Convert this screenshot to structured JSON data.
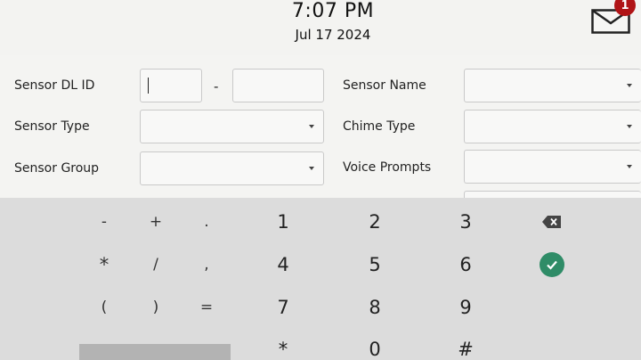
{
  "header": {
    "time": "7:07 PM",
    "date": "Jul 17 2024",
    "mail_icon": "envelope-icon",
    "mail_badge": "1"
  },
  "form": {
    "sensor_dl_id_label": "Sensor DL ID",
    "sensor_dl_id_part1": "",
    "sensor_dl_id_separator": "-",
    "sensor_dl_id_part2": "",
    "sensor_name_label": "Sensor Name",
    "sensor_name_value": "",
    "sensor_type_label": "Sensor Type",
    "sensor_type_value": "",
    "chime_type_label": "Chime Type",
    "chime_type_value": "",
    "sensor_group_label": "Sensor Group",
    "sensor_group_value": "",
    "voice_prompts_label": "Voice Prompts",
    "voice_prompts_value": ""
  },
  "keypad": {
    "row1": [
      "-",
      "+",
      ".",
      "1",
      "2",
      "3"
    ],
    "row2": [
      "*",
      "/",
      ",",
      "4",
      "5",
      "6"
    ],
    "row3": [
      "(",
      ")",
      "=",
      "7",
      "8",
      "9"
    ],
    "row4": [
      "*",
      "0",
      "#"
    ],
    "backspace_icon": "backspace-icon",
    "confirm_icon": "check-circle-icon",
    "accent_color": "#2f8c67"
  }
}
